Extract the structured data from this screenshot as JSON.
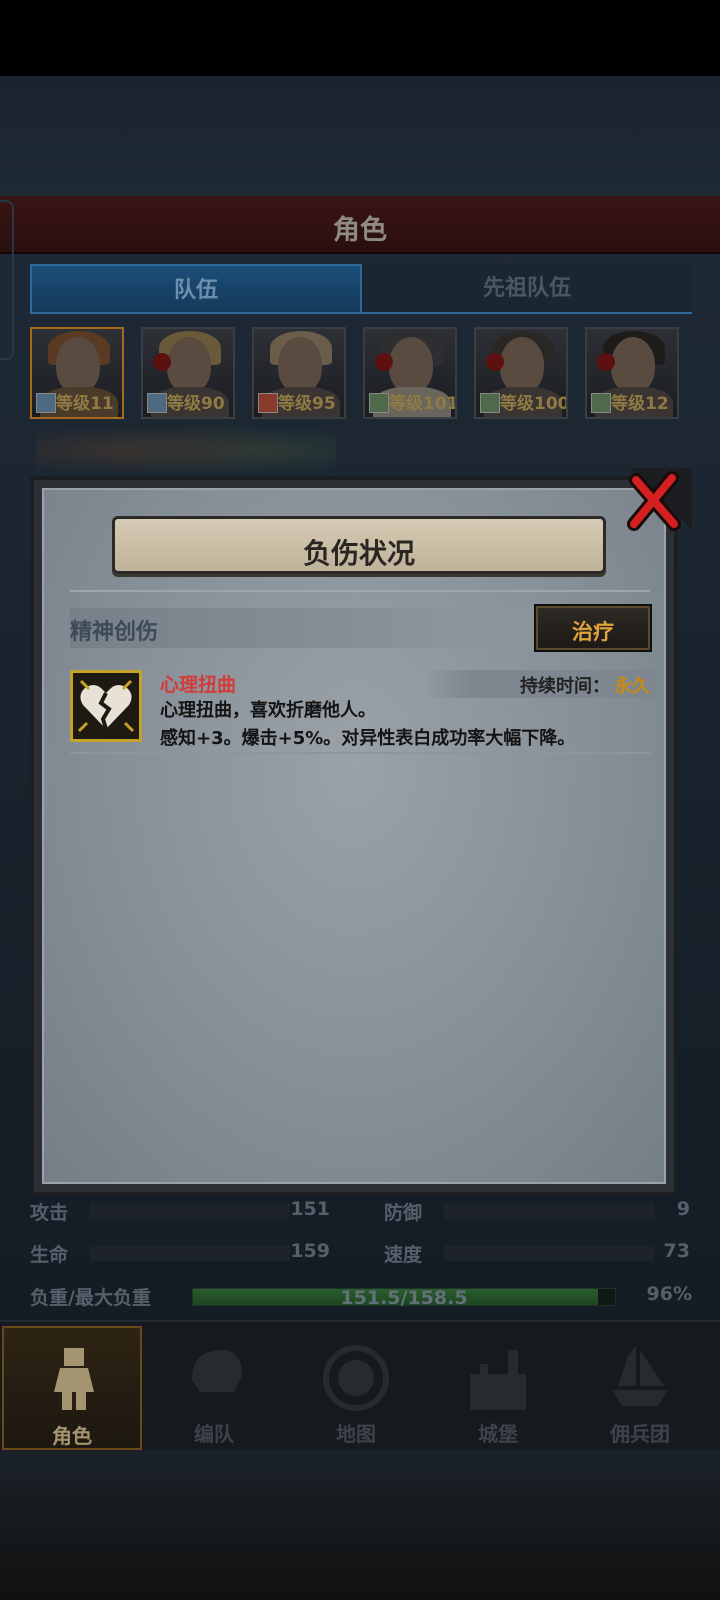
{
  "screen": {
    "title": "角色",
    "tabs": [
      {
        "label": "队伍",
        "active": true
      },
      {
        "label": "先祖队伍",
        "active": false
      }
    ],
    "team": [
      {
        "level": "等级11"
      },
      {
        "level": "等级90"
      },
      {
        "level": "等级95"
      },
      {
        "level": "等级101"
      },
      {
        "level": "等级100"
      },
      {
        "level": "等级12"
      }
    ],
    "stats": [
      {
        "label": "攻击",
        "value": "151"
      },
      {
        "label": "防御",
        "value": "9"
      },
      {
        "label": "生命",
        "value": "159"
      },
      {
        "label": "速度",
        "value": "73"
      }
    ],
    "load": {
      "label": "负重/最大负重",
      "value": "151.5/158.5",
      "percent": "96%",
      "fill_fraction": 0.96
    },
    "nav": [
      {
        "label": "角色",
        "icon": "knight-icon",
        "active": true
      },
      {
        "label": "编队",
        "icon": "helmet-icon",
        "active": false
      },
      {
        "label": "地图",
        "icon": "compass-map-icon",
        "active": false
      },
      {
        "label": "城堡",
        "icon": "castle-icon",
        "active": false
      },
      {
        "label": "佣兵团",
        "icon": "ship-icon",
        "active": false
      }
    ]
  },
  "modal": {
    "title": "负伤状况",
    "section": "精神创伤",
    "treat_button": "治疗",
    "entry": {
      "icon": "broken-heart-icon",
      "name": "心理扭曲",
      "duration_label": "持续时间：",
      "duration_value": "永久",
      "description": "心理扭曲，喜欢折磨他人。",
      "effect": "感知+3。爆击+5%。对异性表白成功率大幅下降。"
    }
  },
  "colors": {
    "accent_red": "#d43a3a",
    "duration_gold": "#c98a12",
    "treat_gold": "#e0a23a",
    "close_red": "#d42020"
  }
}
